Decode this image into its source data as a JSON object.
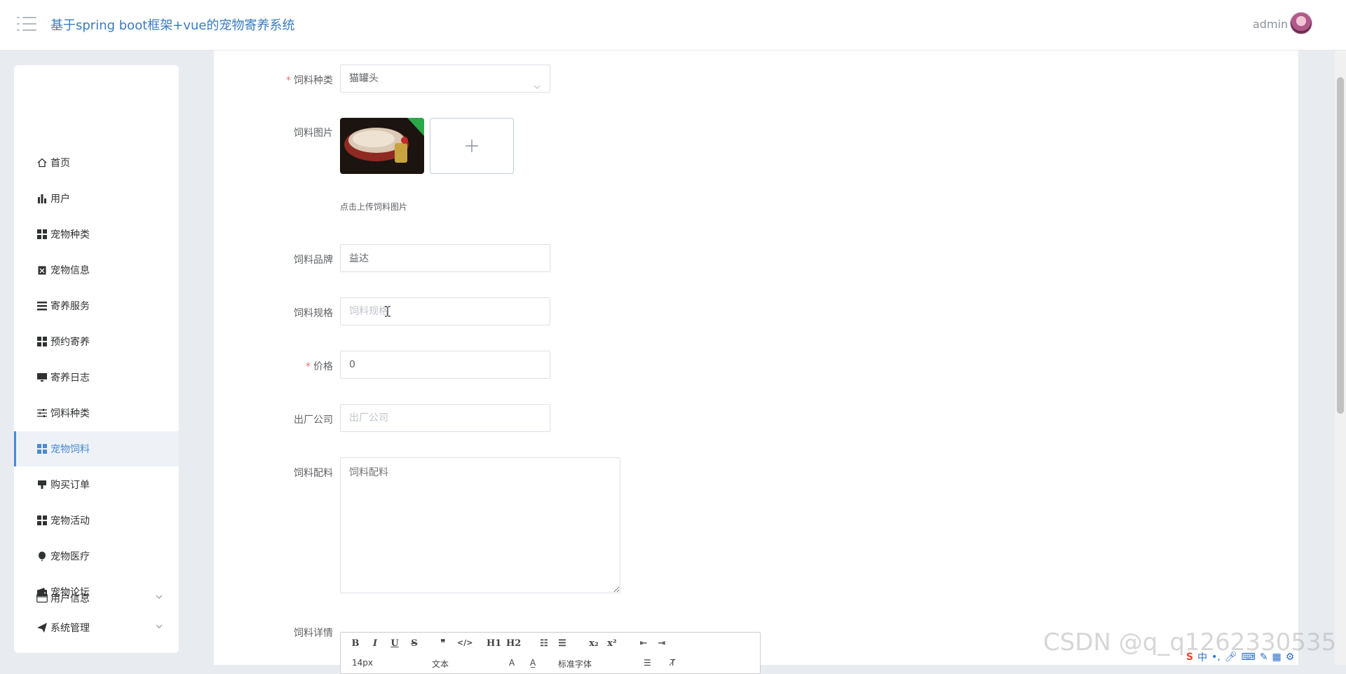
{
  "header": {
    "title": "基于spring boot框架+vue的宠物寄养系统",
    "user_name": "admin"
  },
  "sidebar": {
    "items": [
      {
        "label": "首页",
        "icon": "home-icon"
      },
      {
        "label": "用户",
        "icon": "bar-chart-icon"
      },
      {
        "label": "宠物种类",
        "icon": "grid-icon"
      },
      {
        "label": "宠物信息",
        "icon": "clipboard-icon"
      },
      {
        "label": "寄养服务",
        "icon": "list-icon"
      },
      {
        "label": "预约寄养",
        "icon": "grid-icon"
      },
      {
        "label": "寄养日志",
        "icon": "monitor-icon"
      },
      {
        "label": "饲料种类",
        "icon": "sliders-icon"
      },
      {
        "label": "宠物饲料",
        "icon": "grid-icon",
        "active": true
      },
      {
        "label": "购买订单",
        "icon": "stamp-icon"
      },
      {
        "label": "宠物活动",
        "icon": "grid-icon"
      },
      {
        "label": "宠物医疗",
        "icon": "balloon-icon"
      },
      {
        "label": "宠物论坛",
        "icon": "wallet-icon"
      },
      {
        "label": "系统管理",
        "icon": "paper-plane-icon",
        "expandable": true
      },
      {
        "label": "用户信息",
        "icon": "card-icon",
        "expandable": true
      }
    ]
  },
  "form": {
    "feed_type": {
      "label": "饲料种类",
      "required": true,
      "value": "猫罐头"
    },
    "feed_image": {
      "label": "饲料图片",
      "tip": "点击上传饲料图片"
    },
    "feed_brand": {
      "label": "饲料品牌",
      "value": "益达"
    },
    "feed_spec": {
      "label": "饲料规格",
      "placeholder": "饲料规格"
    },
    "price": {
      "label": "价格",
      "required": true,
      "value": "0"
    },
    "manufacturer": {
      "label": "出厂公司",
      "placeholder": "出厂公司"
    },
    "ingredients": {
      "label": "饲料配料",
      "placeholder": "饲料配料"
    },
    "details": {
      "label": "饲料详情"
    }
  },
  "editor_toolbar": {
    "font_size": "14px",
    "text_type": "文本",
    "font_family": "标准字体",
    "h1": "H1",
    "h2": "H2"
  },
  "watermark": "CSDN @q_q1262330535",
  "tray_text": "中",
  "colors": {
    "accent": "#4a8ad1",
    "title": "#3a7bbf",
    "required": "#f56c6c",
    "sidebar_active_bg": "#eef2f7"
  }
}
